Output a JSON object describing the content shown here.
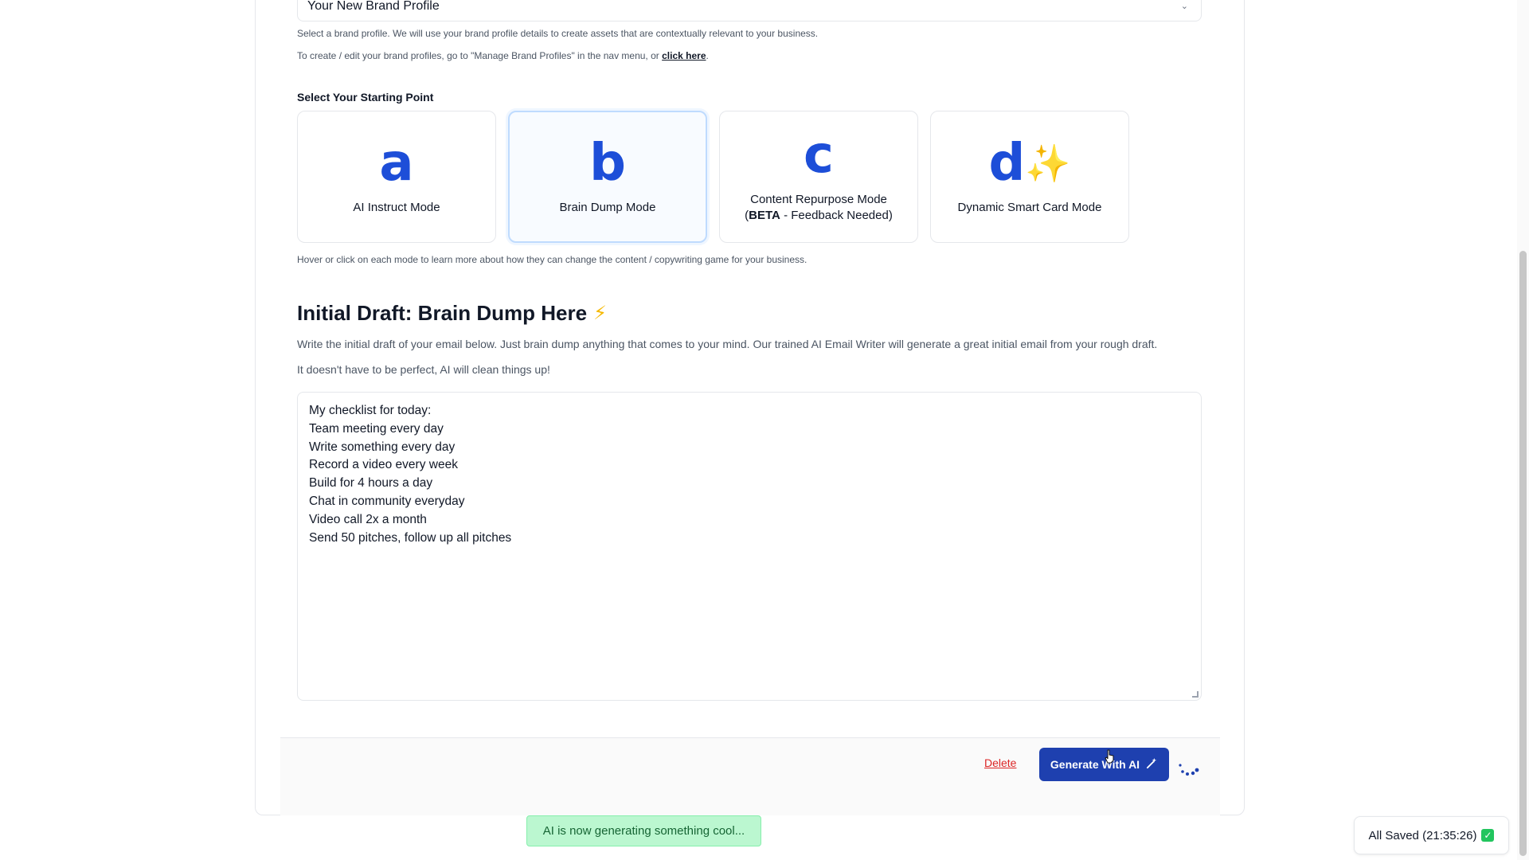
{
  "brand_profile": {
    "selected": "Your New Brand Profile",
    "helper_text": "Select a brand profile. We will use your brand profile details to create assets that are contextually relevant to your business.",
    "manage_text": "To create / edit your brand profiles, go to \"Manage Brand Profiles\" in the nav menu, or",
    "manage_link": "click here"
  },
  "starting_point": {
    "label": "Select Your Starting Point",
    "modes": [
      {
        "letter": "a",
        "label": "AI Instruct Mode"
      },
      {
        "letter": "b",
        "label": "Brain Dump Mode"
      },
      {
        "letter": "c",
        "label_line1": "Content Repurpose Mode",
        "label_line2_bold": "BETA",
        "label_line2_rest": " - Feedback Needed)",
        "label_line2_open": "("
      },
      {
        "letter": "d",
        "label": "Dynamic Smart Card Mode",
        "sparkle": "✨"
      }
    ],
    "hover_hint": "Hover or click on each mode to learn more about how they can change the content / copywriting game for your business."
  },
  "draft": {
    "title": "Initial Draft: Brain Dump Here",
    "title_icon": "⚡",
    "description": "Write the initial draft of your email below. Just brain dump anything that comes to your mind. Our trained AI Email Writer will generate a great initial email from your rough draft.",
    "note": "It doesn't have to be perfect, AI will clean things up!",
    "content": [
      "My checklist for today:",
      "Team meeting every day",
      "Write something every day",
      "Record a video every week",
      "Build for 4 hours a day",
      "Chat in community everyday",
      "Video call 2x a month",
      "Send 50 pitches, follow up all pitches"
    ]
  },
  "actions": {
    "delete_label": "Delete",
    "generate_label": "Generate With AI",
    "generate_icon": "wand-icon"
  },
  "toast": {
    "message": "AI is now generating something cool..."
  },
  "save_status": {
    "text": "All Saved (21:35:26)",
    "check": "✓"
  },
  "colors": {
    "accent": "#1d4ed8",
    "button": "#1e40af",
    "danger": "#dc2626",
    "toast_bg": "#bbf7d0",
    "saved_check": "#22c55e"
  }
}
